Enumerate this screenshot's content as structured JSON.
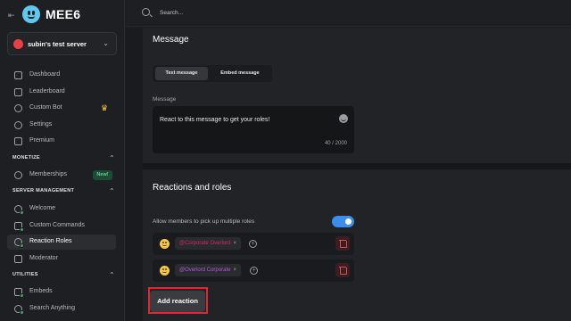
{
  "app": {
    "name": "MEE6"
  },
  "server": {
    "name": "subin's test server"
  },
  "search": {
    "placeholder": "Search..."
  },
  "sidebar": {
    "main_items": [
      {
        "label": "Dashboard"
      },
      {
        "label": "Leaderboard"
      },
      {
        "label": "Custom Bot"
      },
      {
        "label": "Settings"
      },
      {
        "label": "Premium"
      }
    ],
    "sections": {
      "monetize": "MONETIZE",
      "server_management": "SERVER MANAGEMENT",
      "utilities": "UTILITIES"
    },
    "monetize_items": [
      {
        "label": "Memberships",
        "badge": "New!"
      }
    ],
    "server_management_items": [
      {
        "label": "Welcome"
      },
      {
        "label": "Custom Commands"
      },
      {
        "label": "Reaction Roles"
      },
      {
        "label": "Moderator"
      }
    ],
    "utilities_items": [
      {
        "label": "Embeds"
      },
      {
        "label": "Search Anything"
      }
    ]
  },
  "message_card": {
    "title": "Message",
    "tabs": [
      {
        "label": "Text message",
        "selected": true
      },
      {
        "label": "Embed message",
        "selected": false
      }
    ],
    "field_label": "Message",
    "text": "React to this message to get your roles!",
    "counter": "40 / 2000"
  },
  "reactions_card": {
    "title": "Reactions and roles",
    "toggle_label": "Allow members to pick up multiple roles",
    "toggle_on": true,
    "rows": [
      {
        "emoji": "slightly-smiling-face",
        "role": "@Corporate Overlord",
        "role_color": "#e0245e"
      },
      {
        "emoji": "face-with-open-mouth",
        "role": "@Overlord Corporate",
        "role_color": "#b15bd6"
      }
    ],
    "add_reaction_label": "Add reaction"
  }
}
